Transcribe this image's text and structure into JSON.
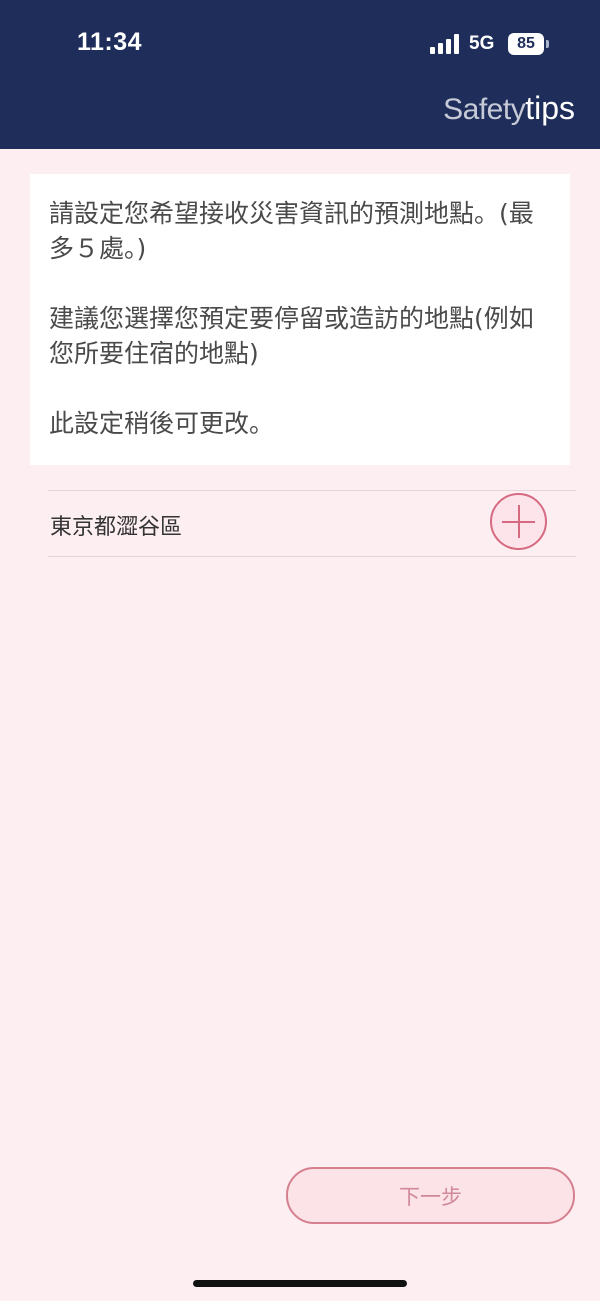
{
  "status_bar": {
    "time": "11:34",
    "network": "5G",
    "battery": "85"
  },
  "brand": {
    "part1": "Safety",
    "part2": "tips"
  },
  "intro": {
    "line1": "請設定您希望接收災害資訊的預測地點。(最多５處。)",
    "line2": "建議您選擇您預定要停留或造訪的地點(例如您所要住宿的地點)",
    "line3": "此設定稍後可更改。"
  },
  "locations": [
    {
      "name": "東京都澀谷區"
    }
  ],
  "next_button": {
    "label": "下一步"
  },
  "colors": {
    "header_bg": "#1f2d5b",
    "page_bg": "#fdeef2",
    "accent": "#d56a80"
  }
}
